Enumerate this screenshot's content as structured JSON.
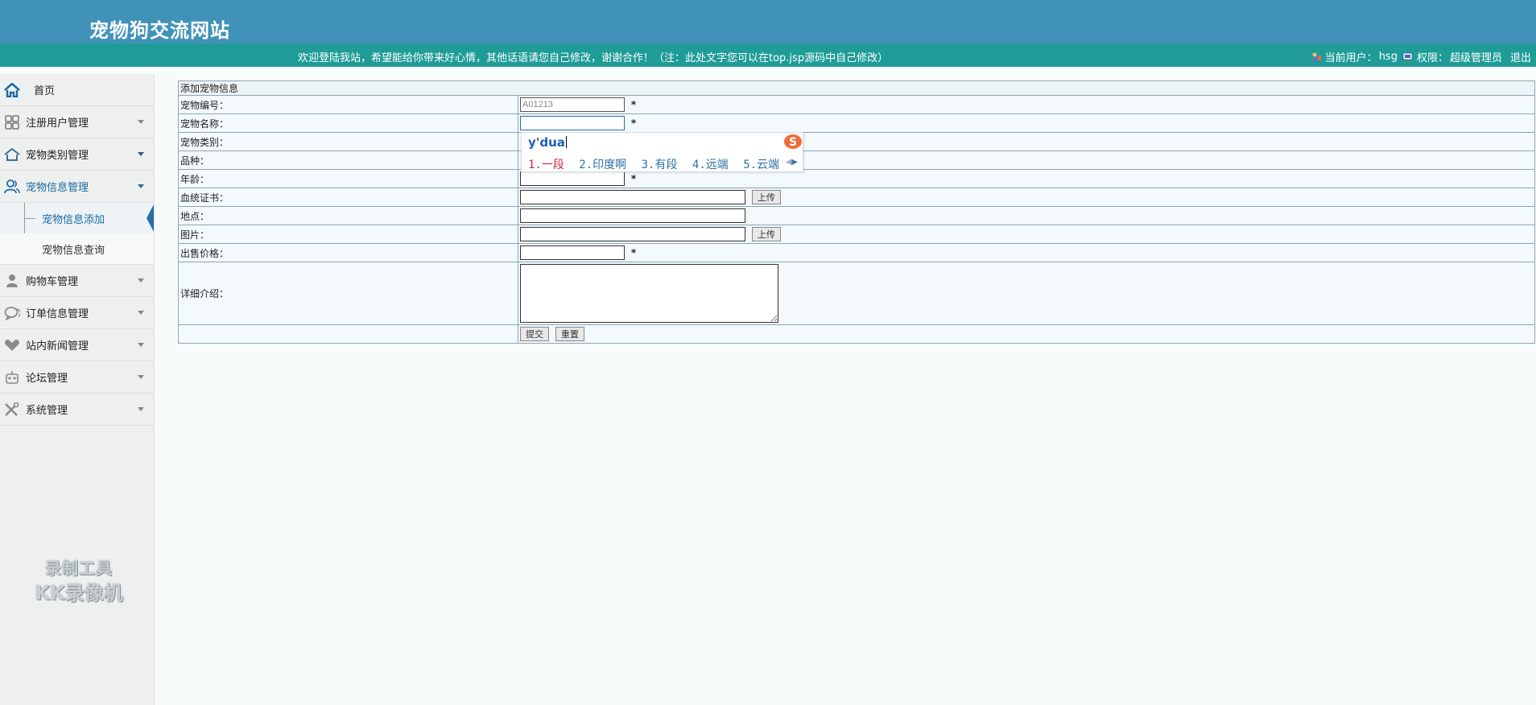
{
  "header": {
    "site_title": "宠物狗交流网站",
    "welcome": "欢迎登陆我站，希望能给你带来好心情，其他话语请您自己修改，谢谢合作！（注：此处文字您可以在top.jsp源码中自己修改）",
    "current_user_label": "当前用户：",
    "current_user": "hsg",
    "role_label": "权限：",
    "role": "超级管理员",
    "logout": "退出"
  },
  "sidebar": {
    "home": "首页",
    "items": [
      {
        "label": "注册用户管理"
      },
      {
        "label": "宠物类别管理"
      },
      {
        "label": "宠物信息管理"
      },
      {
        "label": "购物车管理"
      },
      {
        "label": "订单信息管理"
      },
      {
        "label": "站内新闻管理"
      },
      {
        "label": "论坛管理"
      },
      {
        "label": "系统管理"
      }
    ],
    "subitems": [
      {
        "label": "宠物信息添加"
      },
      {
        "label": "宠物信息查询"
      }
    ]
  },
  "form": {
    "title": "添加宠物信息",
    "fields": {
      "pet_no": {
        "label": "宠物编号：",
        "value": "A01213",
        "required": "*"
      },
      "pet_name": {
        "label": "宠物名称：",
        "value": "",
        "required": "*"
      },
      "pet_category": {
        "label": "宠物类别："
      },
      "breed": {
        "label": "品种："
      },
      "age": {
        "label": "年龄：",
        "value": "",
        "required": "*"
      },
      "pedigree": {
        "label": "血统证书：",
        "value": ""
      },
      "location": {
        "label": "地点：",
        "value": ""
      },
      "image": {
        "label": "图片：",
        "value": ""
      },
      "price": {
        "label": "出售价格：",
        "value": "",
        "required": "*"
      },
      "description": {
        "label": "详细介绍：",
        "value": ""
      }
    },
    "upload_label": "上传",
    "submit_label": "提交",
    "reset_label": "重置"
  },
  "ime": {
    "input": "y'dua",
    "candidates": [
      "1.一段",
      "2.印度啊",
      "3.有段",
      "4.远端",
      "5.云端"
    ],
    "logo_text": "S"
  },
  "watermark": {
    "line1": "录制工具",
    "line2": "KK录像机"
  },
  "colors": {
    "header_bg": "#4192b9",
    "subbar_bg": "#1f9c98",
    "sidebar_bg": "#eef0f0",
    "active_accent": "#2a6ea6"
  }
}
